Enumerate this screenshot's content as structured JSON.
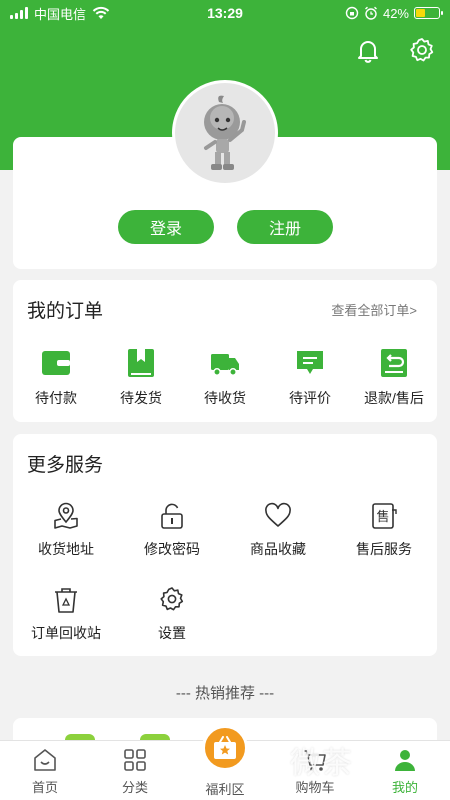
{
  "status_bar": {
    "carrier": "中国电信",
    "time": "13:29",
    "battery": "42%",
    "battery_level": 0.42
  },
  "header": {
    "icons": [
      "bell-icon",
      "settings-gear-icon"
    ]
  },
  "profile": {
    "avatar_icon": "mascot-avatar",
    "login_label": "登录",
    "register_label": "注册"
  },
  "orders": {
    "title": "我的订单",
    "view_all": "查看全部订单>",
    "items": [
      {
        "label": "待付款",
        "icon": "wallet-icon"
      },
      {
        "label": "待发货",
        "icon": "bookmark-box-icon"
      },
      {
        "label": "待收货",
        "icon": "truck-icon"
      },
      {
        "label": "待评价",
        "icon": "comment-icon"
      },
      {
        "label": "退款/售后",
        "icon": "refund-icon"
      }
    ]
  },
  "services": {
    "title": "更多服务",
    "items": [
      {
        "label": "收货地址",
        "icon": "location-icon"
      },
      {
        "label": "修改密码",
        "icon": "lock-icon"
      },
      {
        "label": "商品收藏",
        "icon": "heart-icon"
      },
      {
        "label": "售后服务",
        "icon": "after-sales-icon"
      },
      {
        "label": "订单回收站",
        "icon": "recycle-bin-icon"
      },
      {
        "label": "设置",
        "icon": "gear-icon"
      }
    ]
  },
  "hot": {
    "title": "--- 热销推荐 ---"
  },
  "tabs": [
    {
      "label": "首页",
      "icon": "home-icon"
    },
    {
      "label": "分类",
      "icon": "category-icon"
    },
    {
      "label": "福利区",
      "icon": "gift-icon"
    },
    {
      "label": "购物车",
      "icon": "cart-icon"
    },
    {
      "label": "我的",
      "icon": "user-icon"
    }
  ],
  "watermark": "微茶",
  "colors": {
    "brand_green": "#3db33a",
    "welfare_orange": "#f29a1f",
    "battery_yellow": "#f5d90a"
  }
}
